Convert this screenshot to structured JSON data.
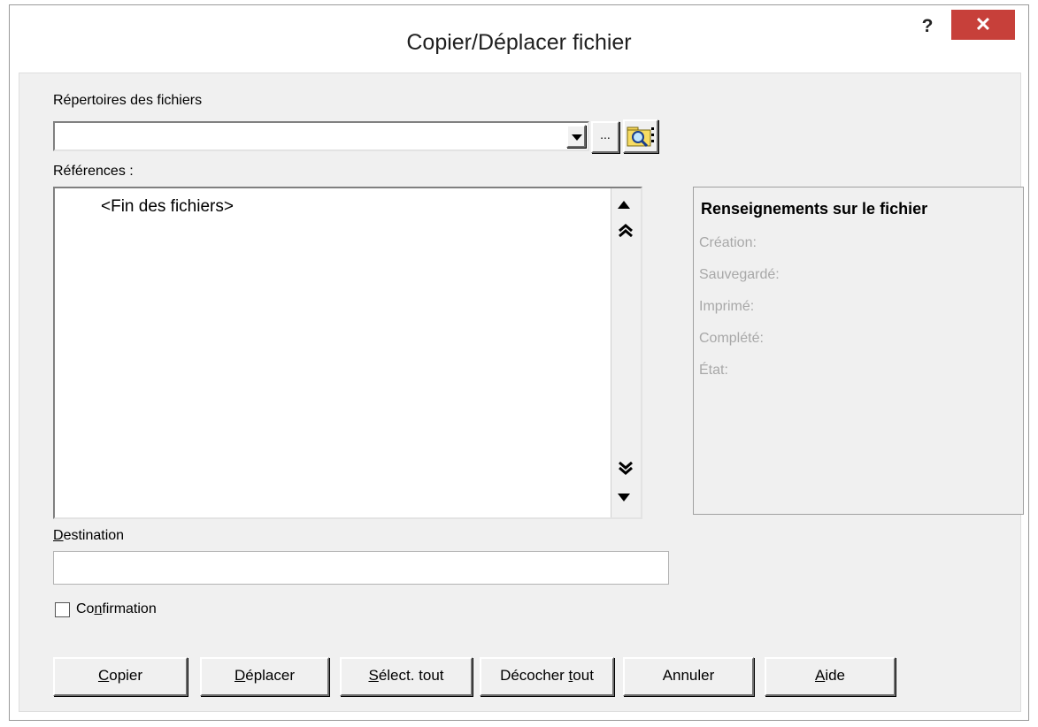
{
  "window": {
    "title": "Copier/Déplacer fichier",
    "help_label": "?",
    "close_label": "✕"
  },
  "directories": {
    "label": "Répertoires des fichiers",
    "value": "",
    "browse_label": "..."
  },
  "references": {
    "label": "Références :",
    "items": [
      "<Fin des fichiers>"
    ]
  },
  "file_info": {
    "title": "Renseignements sur le fichier",
    "rows": [
      "Création:",
      "Sauvegardé:",
      "Imprimé:",
      "Complété:",
      "État:"
    ]
  },
  "destination": {
    "label_first": "D",
    "label_rest": "estination",
    "value": ""
  },
  "confirmation": {
    "label_pre": "Co",
    "label_accel": "n",
    "label_post": "firmation",
    "checked": false
  },
  "buttons": {
    "copier": {
      "accel": "C",
      "rest": "opier"
    },
    "deplacer": {
      "accel": "D",
      "rest": "éplacer"
    },
    "select_all": {
      "accel": "S",
      "rest": "élect. tout"
    },
    "uncheck_all_pre": "Décocher ",
    "uncheck_all_accel": "t",
    "uncheck_all_post": "out",
    "annuler": "Annuler",
    "aide": {
      "accel": "A",
      "rest": "ide"
    }
  }
}
